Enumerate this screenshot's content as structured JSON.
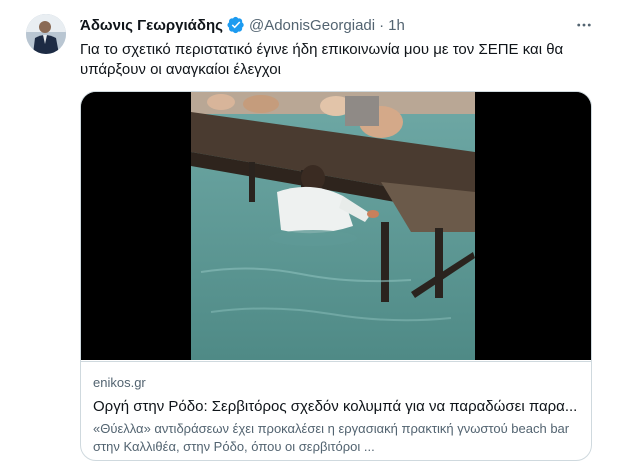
{
  "author": {
    "display_name": "Άδωνις Γεωργιάδης",
    "handle": "@AdonisGeorgiadi",
    "separator": "·",
    "time": "1h"
  },
  "tweet": {
    "text": "Για το σχετικό περιστατικό έγινε ήδη επικοινωνία μου με τον ΣΕΠΕ και θα υπάρξουν οι αναγκαίοι έλεγχοι"
  },
  "card": {
    "domain": "enikos.gr",
    "title": "Οργή στην Ρόδο: Σερβιτόρος σχεδόν κολυμπά για να παραδώσει παρα...",
    "description": "«Θύελλα» αντιδράσεων έχει προκαλέσει η εργασιακή πρακτική γνωστού beach bar στην Καλλιθέα, στην Ρόδο, όπου οι σερβιτόροι ..."
  },
  "icons": {
    "verified": "verified-badge-icon",
    "more": "more-options-icon"
  },
  "colors": {
    "verified": "#1d9bf0",
    "secondary_text": "#536471",
    "primary_text": "#0f1419",
    "border": "#cfd9de"
  }
}
